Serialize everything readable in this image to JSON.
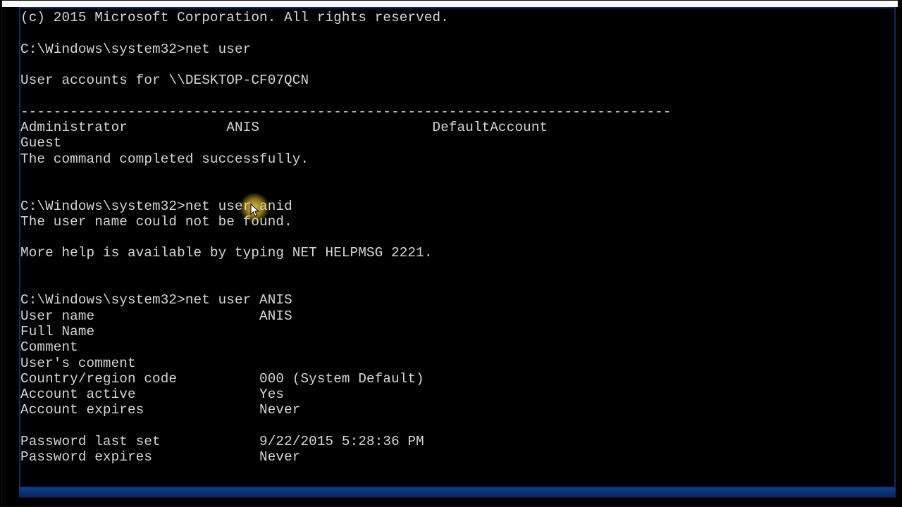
{
  "copyright": "(c) 2015 Microsoft Corporation. All rights reserved.",
  "prompt": "C:\\Windows\\system32>",
  "cmd1": "net user",
  "userAccountsHeader": "User accounts for \\\\DESKTOP-CF07QCN",
  "separator": "-------------------------------------------------------------------------------",
  "accountsLine1_col1": "Administrator",
  "accountsLine1_col2": "ANIS",
  "accountsLine1_col3": "DefaultAccount",
  "accountsLine2_col1": "Guest",
  "completed": "The command completed successfully.",
  "cmd2": "net user anid",
  "notFound": "The user name could not be found.",
  "helpMsg": "More help is available by typing NET HELPMSG 2221.",
  "cmd3": "net user ANIS",
  "details": {
    "User name": "ANIS",
    "Full Name": "",
    "Comment": "",
    "User's comment": "",
    "Country/region code": "000 (System Default)",
    "Account active": "Yes",
    "Account expires": "Never",
    "Password last set": "9/22/2015 5:28:36 PM",
    "Password expires": "Never"
  }
}
